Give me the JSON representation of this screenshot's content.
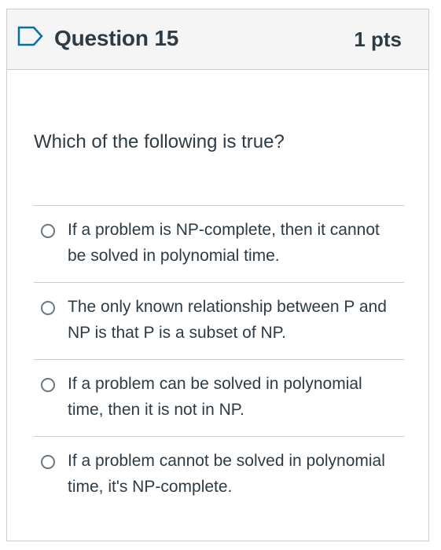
{
  "question": {
    "title": "Question 15",
    "points": "1 pts",
    "prompt": "Which of the following is true?",
    "answers": [
      {
        "label": "If a problem is NP-complete, then it cannot be solved in polynomial time."
      },
      {
        "label": "The only known relationship between P and NP is that P is a subset of NP."
      },
      {
        "label": "If a problem can be solved in polynomial time, then it is not in NP."
      },
      {
        "label": "If a problem cannot be solved in polynomial time, it's NP-complete."
      }
    ]
  },
  "colors": {
    "text": "#2d3b45",
    "header_bg": "#f5f5f5",
    "border": "#c7cdd1",
    "flag_accent": "#0770a3"
  },
  "icons": {
    "flag": "bookmark-flag-icon",
    "radio": "radio-unselected"
  }
}
